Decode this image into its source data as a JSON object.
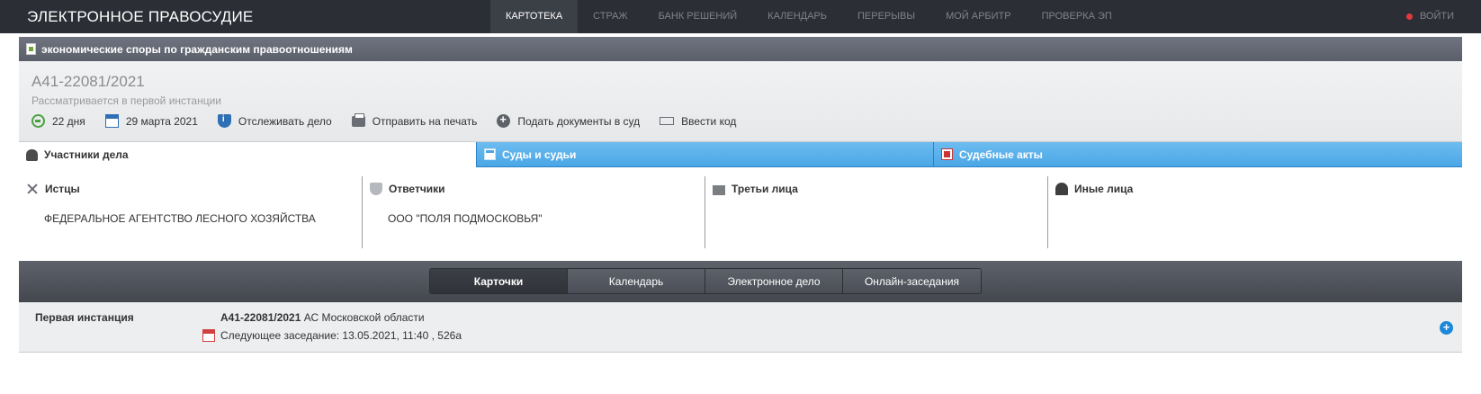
{
  "app": {
    "title": "ЭЛЕКТРОННОЕ ПРАВОСУДИЕ",
    "logout": "ВОЙТИ"
  },
  "nav": [
    "КАРТОТЕКА",
    "СТРАЖ",
    "БАНК РЕШЕНИЙ",
    "КАЛЕНДАРЬ",
    "ПЕРЕРЫВЫ",
    "МОЙ АРБИТР",
    "ПРОВЕРКА ЭП"
  ],
  "category": "экономические споры по гражданским правоотношениям",
  "case": {
    "number": "А41-22081/2021",
    "status": "Рассматривается в первой инстанции",
    "actions": {
      "days": "22 дня",
      "date": "29 марта 2021",
      "track": "Отслеживать дело",
      "print": "Отправить на печать",
      "submit": "Подать документы в суд",
      "code": "Ввести код"
    }
  },
  "tabs": {
    "participants": "Участники дела",
    "courts": "Суды и судьи",
    "acts": "Судебные акты"
  },
  "parties": {
    "plaintiffs": {
      "label": "Истцы",
      "value": "ФЕДЕРАЛЬНОЕ АГЕНТСТВО ЛЕСНОГО ХОЗЯЙСТВА"
    },
    "defendants": {
      "label": "Ответчики",
      "value": "ООО \"ПОЛЯ ПОДМОСКОВЬЯ\""
    },
    "third": {
      "label": "Третьи лица",
      "value": ""
    },
    "other": {
      "label": "Иные лица",
      "value": ""
    }
  },
  "subnav": [
    "Карточки",
    "Календарь",
    "Электронное дело",
    "Онлайн-заседания"
  ],
  "instance": {
    "label": "Первая инстанция",
    "case_number": "А41-22081/2021",
    "court": " АС Московской области",
    "next": "Следующее заседание: 13.05.2021, 11:40 , 526а"
  },
  "colors": {
    "topbar": "#2b2e34",
    "accent_blue": "#4aa6e6",
    "red_dot": "#e33a3a"
  }
}
